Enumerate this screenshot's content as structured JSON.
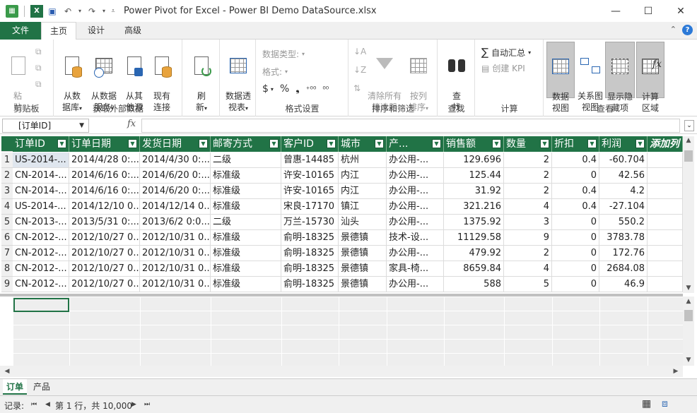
{
  "window": {
    "title": "Power Pivot for Excel - Power BI Demo DataSource.xlsx",
    "minimize_glyph": "—",
    "maximize_glyph": "☐",
    "close_glyph": "✕"
  },
  "ribbon_tabs": {
    "file": "文件",
    "home": "主页",
    "design": "设计",
    "advanced": "高级"
  },
  "ribbon": {
    "clipboard": {
      "label": "剪贴板",
      "paste": "粘\n贴"
    },
    "external": {
      "label": "获取外部数据",
      "from_db": "从数\n据库",
      "from_service": "从数据\n服务",
      "from_other": "从其\n他源",
      "existing": "现有\n连接"
    },
    "refresh": {
      "label": "刷\n新"
    },
    "pivot": {
      "label": "数据透\n视表"
    },
    "format": {
      "label": "格式设置",
      "data_type": "数据类型:",
      "format": "格式:",
      "currency": "$",
      "percent": "%",
      "comma": "❟",
      "dec_inc": "⁺⁰⁰",
      "dec_dec": "⁰⁰"
    },
    "sort": {
      "label": "排序和筛选",
      "clear_filter": "清除所有\n筛选器",
      "sort_by": "按列\n排序"
    },
    "find": {
      "label": "查找",
      "button": "查\n找"
    },
    "calc": {
      "label": "计算",
      "autosum": "自动汇总",
      "kpi": "创建 KPI"
    },
    "view": {
      "label": "查看",
      "data_view": "数据\n视图",
      "diagram_view": "关系图\n视图",
      "show_hidden": "显示隐\n藏项",
      "calc_area": "计算\n区域"
    }
  },
  "formula_bar": {
    "name_box": "[订单ID]",
    "fx": "fx"
  },
  "table": {
    "columns": [
      "订单ID",
      "订单日期",
      "发货日期",
      "邮寄方式",
      "客户ID",
      "城市",
      "产...",
      "销售额",
      "数量",
      "折扣",
      "利润"
    ],
    "add_column": "添加列",
    "rows": [
      [
        "1",
        "US-2014-...",
        "2014/4/28 0:...",
        "2014/4/30 0:...",
        "二级",
        "曾惠-14485",
        "杭州",
        "办公用-...",
        "129.696",
        "2",
        "0.4",
        "-60.704"
      ],
      [
        "2",
        "CN-2014-...",
        "2014/6/16 0:...",
        "2014/6/20 0:...",
        "标准级",
        "许安-10165",
        "内江",
        "办公用-...",
        "125.44",
        "2",
        "0",
        "42.56"
      ],
      [
        "3",
        "CN-2014-...",
        "2014/6/16 0:...",
        "2014/6/20 0:...",
        "标准级",
        "许安-10165",
        "内江",
        "办公用-...",
        "31.92",
        "2",
        "0.4",
        "4.2"
      ],
      [
        "4",
        "US-2014-...",
        "2014/12/10 0...",
        "2014/12/14 0...",
        "标准级",
        "宋良-17170",
        "镇江",
        "办公用-...",
        "321.216",
        "4",
        "0.4",
        "-27.104"
      ],
      [
        "5",
        "CN-2013-...",
        "2013/5/31 0:...",
        "2013/6/2 0:0...",
        "二级",
        "万兰-15730",
        "汕头",
        "办公用-...",
        "1375.92",
        "3",
        "0",
        "550.2"
      ],
      [
        "6",
        "CN-2012-...",
        "2012/10/27 0...",
        "2012/10/31 0...",
        "标准级",
        "俞明-18325",
        "景德镇",
        "技术-设...",
        "11129.58",
        "9",
        "0",
        "3783.78"
      ],
      [
        "7",
        "CN-2012-...",
        "2012/10/27 0...",
        "2012/10/31 0...",
        "标准级",
        "俞明-18325",
        "景德镇",
        "办公用-...",
        "479.92",
        "2",
        "0",
        "172.76"
      ],
      [
        "8",
        "CN-2012-...",
        "2012/10/27 0...",
        "2012/10/31 0...",
        "标准级",
        "俞明-18325",
        "景德镇",
        "家具-椅...",
        "8659.84",
        "4",
        "0",
        "2684.08"
      ],
      [
        "9",
        "CN-2012-...",
        "2012/10/27 0...",
        "2012/10/31 0...",
        "标准级",
        "俞明-18325",
        "景德镇",
        "办公用-...",
        "588",
        "5",
        "0",
        "46.9"
      ]
    ]
  },
  "sheets": [
    "订单",
    "产品"
  ],
  "status": {
    "record_label": "记录:",
    "position": "第 1 行，共 10,000"
  }
}
